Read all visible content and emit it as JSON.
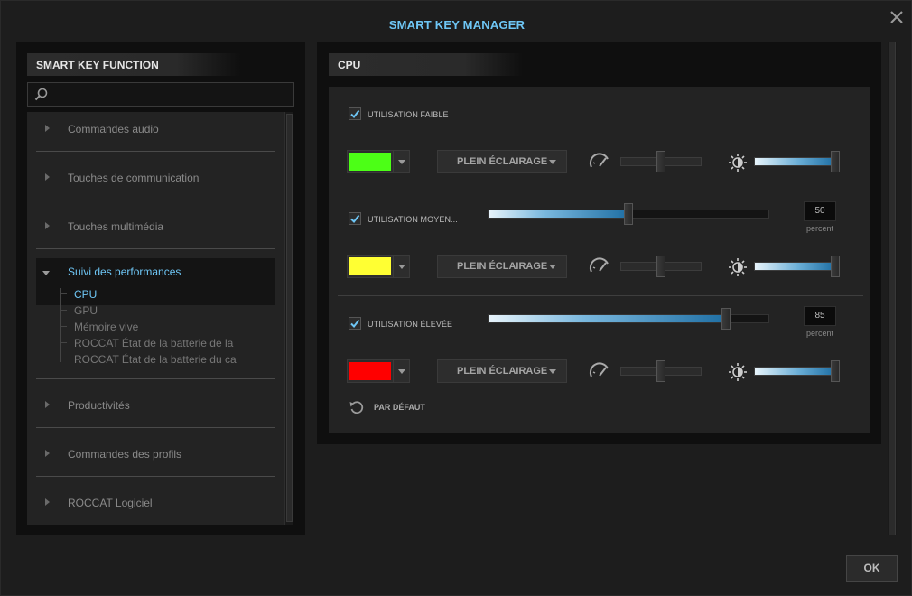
{
  "window": {
    "title": "SMART KEY MANAGER"
  },
  "left_panel": {
    "header": "SMART KEY FUNCTION",
    "search": {
      "value": "",
      "placeholder": ""
    },
    "categories": [
      {
        "label": "Commandes audio",
        "expanded": false
      },
      {
        "label": "Touches de communication",
        "expanded": false
      },
      {
        "label": "Touches multimédia",
        "expanded": false
      },
      {
        "label": "Suivi des performances",
        "expanded": true,
        "children": [
          {
            "label": "CPU",
            "selected": true
          },
          {
            "label": "GPU"
          },
          {
            "label": "Mémoire vive"
          },
          {
            "label": "ROCCAT État de la batterie de la"
          },
          {
            "label": "ROCCAT État de la batterie du ca"
          }
        ]
      },
      {
        "label": "Productivités",
        "expanded": false
      },
      {
        "label": "Commandes des profils",
        "expanded": false
      },
      {
        "label": "ROCCAT Logiciel",
        "expanded": false
      }
    ]
  },
  "right_panel": {
    "header": "CPU",
    "levels": [
      {
        "label": "UTILISATION FAIBLE",
        "checked": true,
        "color": "#4cff16",
        "effect": "PLEIN ÉCLAIRAGE",
        "speed": 0.5,
        "brightness": 1.0
      },
      {
        "label": "UTILISATION MOYEN...",
        "checked": true,
        "threshold": "50",
        "unit": "percent",
        "color": "#ffff33",
        "effect": "PLEIN ÉCLAIRAGE",
        "speed": 0.5,
        "brightness": 1.0
      },
      {
        "label": "UTILISATION ÉLEVÉE",
        "checked": true,
        "threshold": "85",
        "unit": "percent",
        "color": "#ff0000",
        "effect": "PLEIN ÉCLAIRAGE",
        "speed": 0.5,
        "brightness": 1.0
      }
    ],
    "default_label": "PAR DÉFAUT"
  },
  "footer": {
    "ok_label": "OK"
  }
}
